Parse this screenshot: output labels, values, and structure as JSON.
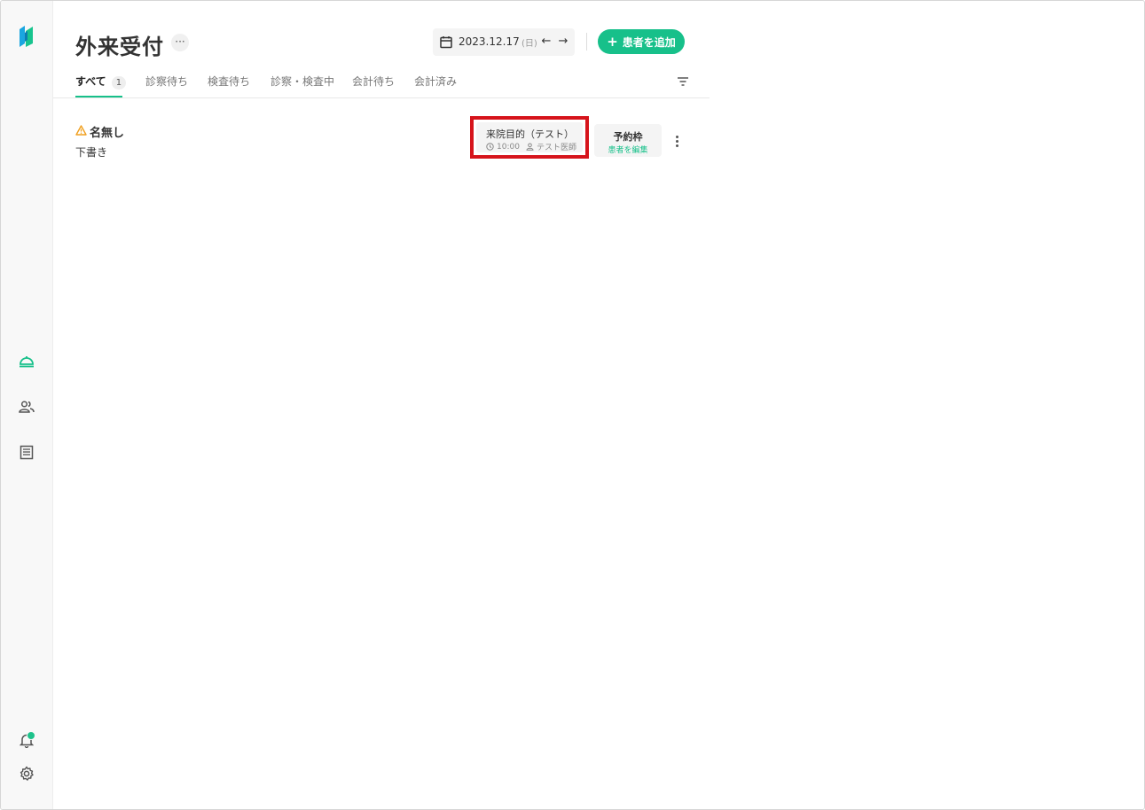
{
  "page": {
    "title": "外来受付",
    "more_label": "···"
  },
  "date": {
    "value": "2023.12.17",
    "day_of_week": "(日)",
    "prev_label": "←",
    "next_label": "→"
  },
  "add_button": {
    "icon": "+",
    "label": "患者を追加"
  },
  "tabs": [
    {
      "label": "すべて",
      "count": "1",
      "active": true
    },
    {
      "label": "診察待ち"
    },
    {
      "label": "検査待ち"
    },
    {
      "label": "診察・検査中"
    },
    {
      "label": "会計待ち"
    },
    {
      "label": "会計済み"
    }
  ],
  "patient": {
    "name": "名無し",
    "status": "下書き",
    "purpose_title": "来院目的（テスト）",
    "time": "10:00",
    "doctor": "テスト医師",
    "slot_title": "予約枠",
    "slot_action": "患者を編集"
  },
  "colors": {
    "accent": "#17c08a",
    "highlight_box": "#d6141b",
    "warning": "#f0a020"
  },
  "icons": [
    "logo-icon",
    "reception-bell-icon",
    "patients-icon",
    "records-icon",
    "notification-bell-icon",
    "settings-gear-icon",
    "calendar-icon",
    "filter-icon",
    "warning-icon",
    "clock-icon",
    "person-icon",
    "kebab-menu-icon"
  ]
}
